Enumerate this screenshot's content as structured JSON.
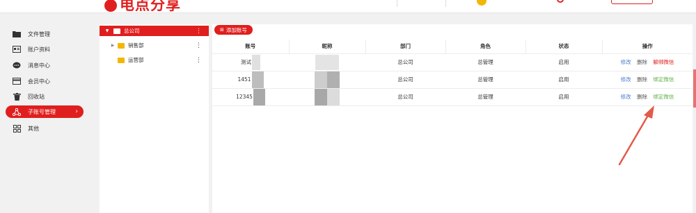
{
  "topbar": {
    "logo_text": "电点分享"
  },
  "sidebar": {
    "items": [
      {
        "label": "文件管理",
        "icon": "folder-icon"
      },
      {
        "label": "账户资料",
        "icon": "id-card-icon"
      },
      {
        "label": "消息中心",
        "icon": "chat-icon"
      },
      {
        "label": "会员中心",
        "icon": "card-icon"
      },
      {
        "label": "回收站",
        "icon": "trash-icon"
      },
      {
        "label": "子账号管理",
        "icon": "sub-account-icon",
        "active": true
      },
      {
        "label": "其他",
        "icon": "grid-icon"
      }
    ]
  },
  "tree": {
    "root": {
      "label": "总公司"
    },
    "children": [
      {
        "label": "销售部",
        "has_children": true
      },
      {
        "label": "运营部",
        "has_children": false
      }
    ]
  },
  "toolbar": {
    "add_label": "添加账号"
  },
  "table": {
    "headers": [
      "账号",
      "昵称",
      "部门",
      "角色",
      "状态",
      "操作"
    ],
    "rows": [
      {
        "account": "测试",
        "dept": "总公司",
        "role": "总管理",
        "status": "启用",
        "ops": [
          "修改",
          "删除",
          "解绑微信"
        ]
      },
      {
        "account": "1451",
        "dept": "总公司",
        "role": "总管理",
        "status": "启用",
        "ops": [
          "修改",
          "删除",
          "绑定微信"
        ]
      },
      {
        "account": "12345",
        "dept": "总公司",
        "role": "总管理",
        "status": "启用",
        "ops": [
          "修改",
          "删除",
          "绑定微信"
        ]
      }
    ]
  },
  "colors": {
    "accent": "#e01e1e",
    "link_blue": "#4a7bd0",
    "bind_green": "#63b04a",
    "folder_yellow": "#f2b705"
  }
}
